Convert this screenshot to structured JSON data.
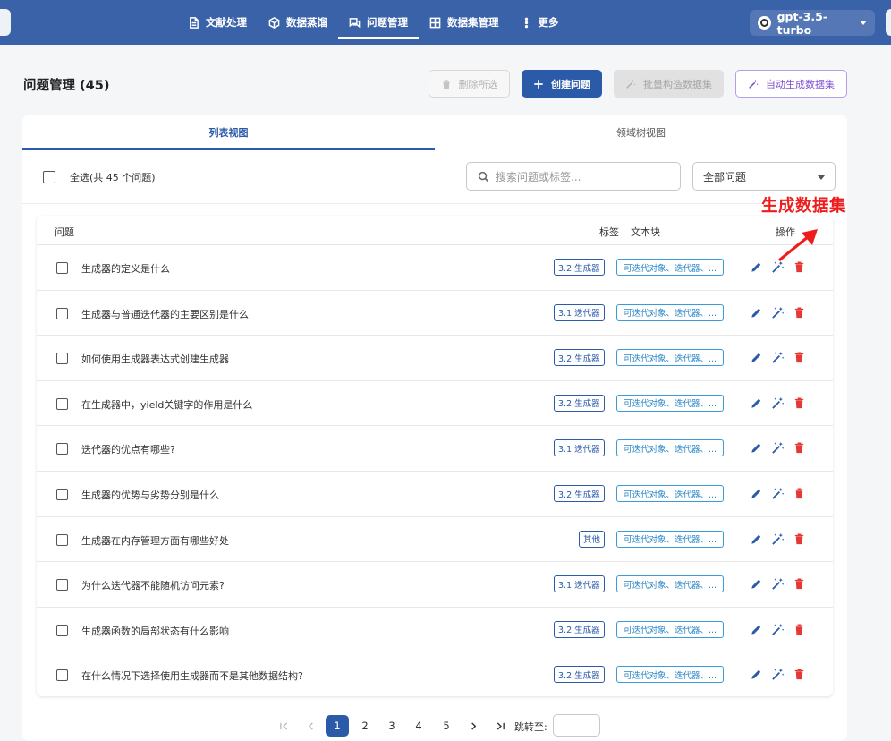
{
  "nav": {
    "items": [
      {
        "label": "文献处理",
        "icon": "document-icon"
      },
      {
        "label": "数据蒸馏",
        "icon": "cube-icon"
      },
      {
        "label": "问题管理",
        "icon": "chat-icon",
        "active": true
      },
      {
        "label": "数据集管理",
        "icon": "grid-icon"
      },
      {
        "label": "更多",
        "icon": "more-vertical-icon"
      }
    ],
    "model": "gpt-3.5-turbo"
  },
  "header": {
    "title": "问题管理 (45)",
    "delete_label": "删除所选",
    "create_label": "创建问题",
    "batch_label": "批量构造数据集",
    "auto_label": "自动生成数据集"
  },
  "tabs": {
    "list": "列表视图",
    "tree": "领域树视图"
  },
  "toolbar": {
    "select_all": "全选(共 45 个问题)",
    "search_placeholder": "搜索问题或标签...",
    "filter_value": "全部问题"
  },
  "table": {
    "headers": {
      "question": "问题",
      "tag": "标签",
      "chunk": "文本块",
      "actions": "操作"
    },
    "rows": [
      {
        "question": "生成器的定义是什么",
        "tag": "3.2 生成器",
        "chunk": "可迭代对象、迭代器、..."
      },
      {
        "question": "生成器与普通迭代器的主要区别是什么",
        "tag": "3.1 迭代器",
        "chunk": "可迭代对象、迭代器、..."
      },
      {
        "question": "如何使用生成器表达式创建生成器",
        "tag": "3.2 生成器",
        "chunk": "可迭代对象、迭代器、..."
      },
      {
        "question": "在生成器中，yield关键字的作用是什么",
        "tag": "3.2 生成器",
        "chunk": "可迭代对象、迭代器、..."
      },
      {
        "question": "迭代器的优点有哪些?",
        "tag": "3.1 迭代器",
        "chunk": "可迭代对象、迭代器、..."
      },
      {
        "question": "生成器的优势与劣势分别是什么",
        "tag": "3.2 生成器",
        "chunk": "可迭代对象、迭代器、..."
      },
      {
        "question": "生成器在内存管理方面有哪些好处",
        "tag": "其他",
        "chunk": "可迭代对象、迭代器、..."
      },
      {
        "question": "为什么迭代器不能随机访问元素?",
        "tag": "3.1 迭代器",
        "chunk": "可迭代对象、迭代器、..."
      },
      {
        "question": "生成器函数的局部状态有什么影响",
        "tag": "3.2 生成器",
        "chunk": "可迭代对象、迭代器、..."
      },
      {
        "question": "在什么情况下选择使用生成器而不是其他数据结构?",
        "tag": "3.2 生成器",
        "chunk": "可迭代对象、迭代器、..."
      }
    ]
  },
  "annotation": {
    "label": "生成数据集"
  },
  "pagination": {
    "pages": [
      "1",
      "2",
      "3",
      "4",
      "5"
    ],
    "current": "1",
    "jump_label": "跳转至:"
  },
  "colors": {
    "nav_bg": "#3a62a8",
    "primary": "#2b5aa8",
    "accent_purple": "#7e4fd3",
    "chunk_blue": "#2a86c4",
    "edit_icon": "#2b5aa8",
    "magic_icon": "#2b5aa8",
    "delete_icon": "#e53935",
    "annotation_red": "#ee1c1c"
  }
}
